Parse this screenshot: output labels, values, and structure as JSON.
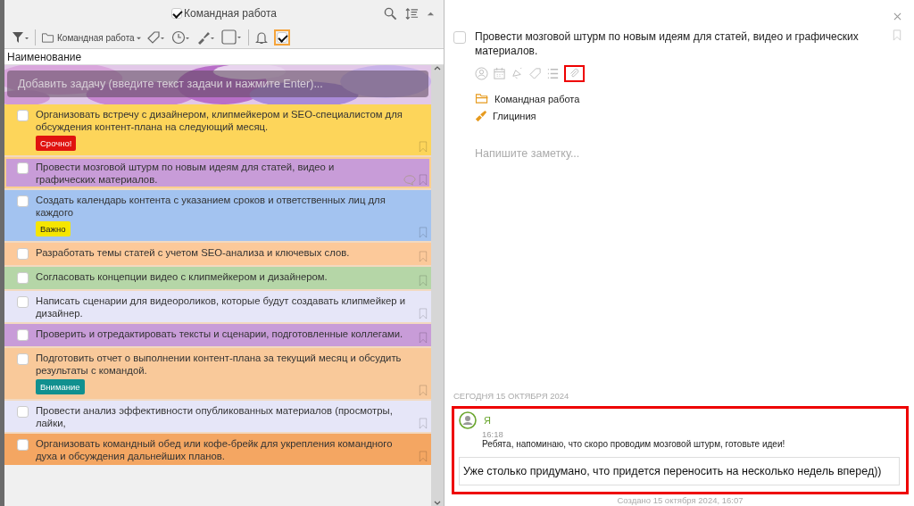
{
  "list_panel": {
    "title": "Командная работа",
    "title_checked": true,
    "toolbar": {
      "folder": "Командная работа",
      "completed_filter_on": true
    },
    "column_header": "Наименование",
    "add_task": {
      "placeholder": "Добавить задачу (введите текст задачи и нажмите Enter)..."
    },
    "tasks": [
      {
        "text": "Организовать встречу с дизайнером, клипмейкером и SEO-специалистом для обсуждения контент-плана на следующий месяц.",
        "color": "#fdd55a",
        "checked": false,
        "selected": false,
        "tag": {
          "label": "Срочно!",
          "color": "#e0120f"
        }
      },
      {
        "text": "Провести мозговой штурм по новым идеям для статей, видео и графических материалов.",
        "color": "#c89cd8",
        "checked": false,
        "selected": true,
        "has_comments": true
      },
      {
        "text": "Создать календарь контента с указанием сроков и ответственных лиц для каждого",
        "color": "#a3c3f0",
        "checked": false,
        "selected": false,
        "tag": {
          "label": "Важно",
          "color": "#f5e500"
        }
      },
      {
        "text": "Разработать темы статей с учетом SEO-анализа и ключевых слов.",
        "color": "#fcc99a",
        "checked": false,
        "selected": false
      },
      {
        "text": "Согласовать концепции видео с клипмейкером и дизайнером.",
        "color": "#b5d6a7",
        "checked": false,
        "selected": false
      },
      {
        "text": "Написать сценарии для видеороликов, которые будут создавать клипмейкер и дизайнер.",
        "color": "#e6e6f8",
        "checked": false,
        "selected": false
      },
      {
        "text": "Проверить и отредактировать тексты и сценарии, подготовленные коллегами.",
        "color": "#c89cd8",
        "checked": false,
        "selected": false
      },
      {
        "text": "Подготовить отчет о выполнении контент-плана за текущий месяц и обсудить результаты с командой.",
        "color": "#f9c99a",
        "checked": false,
        "selected": false,
        "tag": {
          "label": "Внимание",
          "color": "#11908f"
        }
      },
      {
        "text": "Провести анализ эффективности опубликованных материалов (просмотры, лайки,",
        "color": "#e6e6f8",
        "checked": false,
        "selected": false
      },
      {
        "text": "Организовать командный обед или кофе-брейк для укрепления командного духа и обсуждения дальнейших планов.",
        "color": "#f4a662",
        "checked": false,
        "selected": false
      }
    ]
  },
  "detail_panel": {
    "task_title": "Провести мозговой штурм по новым идеям для статей, видео и графических материалов.",
    "checked": false,
    "properties": [
      {
        "kind": "folder",
        "text": "Командная работа"
      },
      {
        "kind": "color",
        "text": "Глициния"
      }
    ],
    "note": {
      "placeholder": "Напишите заметку..."
    },
    "date_header": "СЕГОДНЯ 15 ОКТЯБРЯ 2024",
    "comment": {
      "author": "Я",
      "time": "16:18",
      "text": "Ребята, напоминаю, что скоро проводим мозговой штурм, готовьте идеи!"
    },
    "reply": {
      "value": "Уже столько придумано, что придется переносить на несколько недель вперед))"
    },
    "created": "Создано 15 октября 2024, 16:07"
  }
}
